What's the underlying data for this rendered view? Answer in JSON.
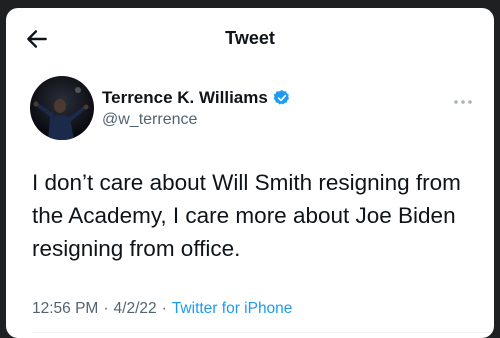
{
  "header": {
    "title": "Tweet"
  },
  "tweet": {
    "author": {
      "display_name": "Terrence K. Williams",
      "handle": "@w_terrence",
      "verified": true
    },
    "text": "I don’t care about Will Smith resigning from the Academy, I care more about Joe Biden resigning from office.",
    "time": "12:56 PM",
    "date": "4/2/22",
    "separator": "·",
    "source": "Twitter for iPhone"
  },
  "icons": {
    "back": "arrow-left-icon",
    "verified": "verified-badge-icon",
    "more": "more-horizontal-icon"
  },
  "colors": {
    "accent": "#1d9bf0",
    "text": "#0f1419",
    "muted": "#536471"
  }
}
